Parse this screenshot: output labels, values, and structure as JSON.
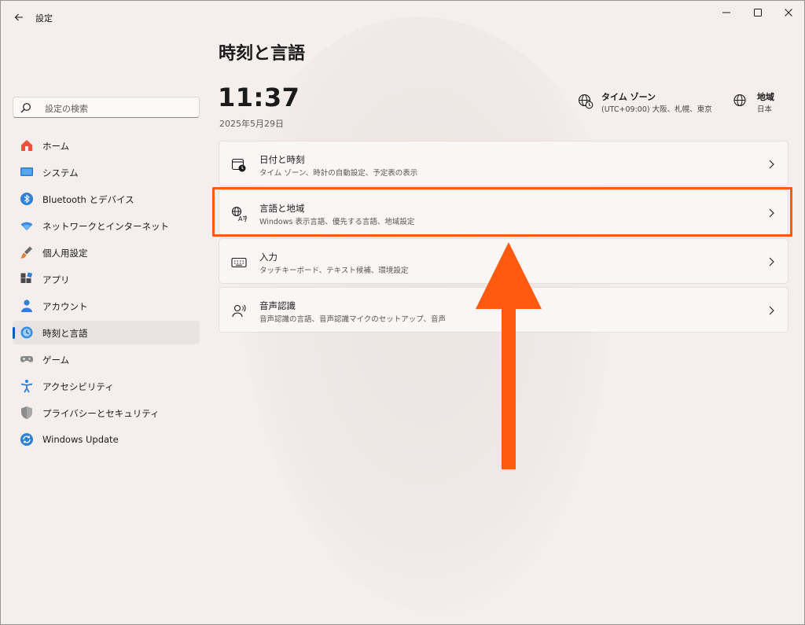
{
  "window": {
    "app_title": "設定",
    "controls": [
      "minimize-icon",
      "maximize-icon",
      "close-icon"
    ]
  },
  "sidebar": {
    "search_placeholder": "設定の検索",
    "items": [
      {
        "label": "ホーム",
        "icon": "home-icon",
        "selected": false
      },
      {
        "label": "システム",
        "icon": "system-icon",
        "selected": false
      },
      {
        "label": "Bluetooth とデバイス",
        "icon": "bluetooth-icon",
        "selected": false
      },
      {
        "label": "ネットワークとインターネット",
        "icon": "wifi-icon",
        "selected": false
      },
      {
        "label": "個人用設定",
        "icon": "brush-icon",
        "selected": false
      },
      {
        "label": "アプリ",
        "icon": "apps-icon",
        "selected": false
      },
      {
        "label": "アカウント",
        "icon": "account-icon",
        "selected": false
      },
      {
        "label": "時刻と言語",
        "icon": "time-language-icon",
        "selected": true
      },
      {
        "label": "ゲーム",
        "icon": "gamepad-icon",
        "selected": false
      },
      {
        "label": "アクセシビリティ",
        "icon": "accessibility-icon",
        "selected": false
      },
      {
        "label": "プライバシーとセキュリティ",
        "icon": "shield-icon",
        "selected": false
      },
      {
        "label": "Windows Update",
        "icon": "update-icon",
        "selected": false
      }
    ]
  },
  "main": {
    "page_title": "時刻と言語",
    "time": "11:37",
    "date": "2025年5月29日",
    "timezone": {
      "title": "タイム ゾーン",
      "value": "(UTC+09:00) 大阪、札幌、東京"
    },
    "region": {
      "title": "地域",
      "value": "日本"
    },
    "cards": [
      {
        "title": "日付と時刻",
        "subtitle": "タイム ゾーン、時計の自動設定、予定表の表示",
        "icon": "calendar-clock-icon"
      },
      {
        "title": "言語と地域",
        "subtitle": "Windows 表示言語、優先する言語、地域設定",
        "icon": "language-icon"
      },
      {
        "title": "入力",
        "subtitle": "タッチキーボード、テキスト候補、環境設定",
        "icon": "keyboard-icon"
      },
      {
        "title": "音声認識",
        "subtitle": "音声認識の言語、音声認識マイクのセットアップ、音声",
        "icon": "speech-icon"
      }
    ]
  },
  "annotation": {
    "highlight_color": "#ff5a10",
    "arrow_color": "#ff5a10"
  },
  "colors": {
    "accent": "#005fb8",
    "background": "#f4eeec"
  }
}
